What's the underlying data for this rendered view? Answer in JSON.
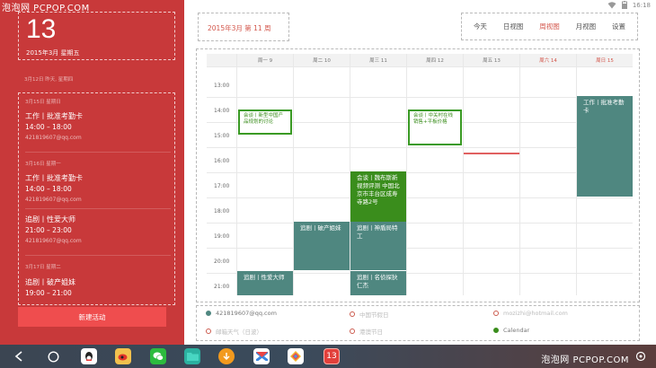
{
  "watermark": "泡泡网 PCPOP.COM",
  "status_bar": {
    "time": "16:18"
  },
  "sidebar": {
    "date_number": "13",
    "date_sub": "2015年3月 星期五",
    "past_header": "3月12日 昨天, 星期四",
    "agenda": [
      {
        "date": "3月15日 星期日",
        "title": "工作丨批准考勤卡",
        "time": "14:00 – 18:00",
        "email": "421819607@qq.com"
      },
      {
        "date": "3月16日 星期一",
        "title": "工作丨批准考勤卡",
        "time": "14:00 – 18:00",
        "email": "421819607@qq.com"
      },
      {
        "date": "",
        "title": "追剧丨性爱大师",
        "time": "21:00 – 23:00",
        "email": "421819607@qq.com"
      },
      {
        "date": "3月17日 星期二",
        "title": "追剧丨破产姐妹",
        "time": "19:00 – 21:00",
        "email": ""
      }
    ],
    "new_event_label": "新建活动"
  },
  "header": {
    "title": "2015年3月 第 11 周",
    "views": [
      "今天",
      "日视图",
      "周视图",
      "月视图",
      "设置"
    ],
    "active_view": "周视图"
  },
  "calendar": {
    "days": [
      "周一 9",
      "周二 10",
      "周三 11",
      "周四 12",
      "周五 13",
      "周六 14",
      "周日 15"
    ],
    "hours": [
      "13:00",
      "14:00",
      "15:00",
      "16:00",
      "17:00",
      "18:00",
      "19:00",
      "20:00",
      "21:00"
    ],
    "events": [
      {
        "text": "会谈丨新型中国产品规划的讨论",
        "style": "outline"
      },
      {
        "text": "会谈丨中关村在线销售+平板价格",
        "style": "outline"
      },
      {
        "text": "工作丨批准考勤卡",
        "style": "teal"
      },
      {
        "text": "会谈丨魏布斯新视频评测 中国北京市丰台区成寿寺路2号",
        "style": "green"
      },
      {
        "text": "追剧丨破产姐妹",
        "style": "teal"
      },
      {
        "text": "追剧丨神盾局特工",
        "style": "teal"
      },
      {
        "text": "追剧丨性爱大师",
        "style": "teal"
      },
      {
        "text": "追剧丨名侦探狄仁杰",
        "style": "teal"
      }
    ]
  },
  "legend": [
    {
      "label": "421819607@qq.com",
      "style": "filled-teal"
    },
    {
      "label": "中国节假日",
      "style": "ring"
    },
    {
      "label": "mozizhi@hotmail.com",
      "style": "ring"
    },
    {
      "label": "邮箱天气（日波）",
      "style": "ring"
    },
    {
      "label": "港澳节日",
      "style": "ring"
    },
    {
      "label": "Calendar",
      "style": "filled-green"
    }
  ],
  "taskbar": {
    "calendar_badge": "13"
  },
  "colors": {
    "sidebar": "#c8393a",
    "accent": "#d3564b",
    "teal": "#4f8780",
    "green": "#3a8d1c"
  }
}
